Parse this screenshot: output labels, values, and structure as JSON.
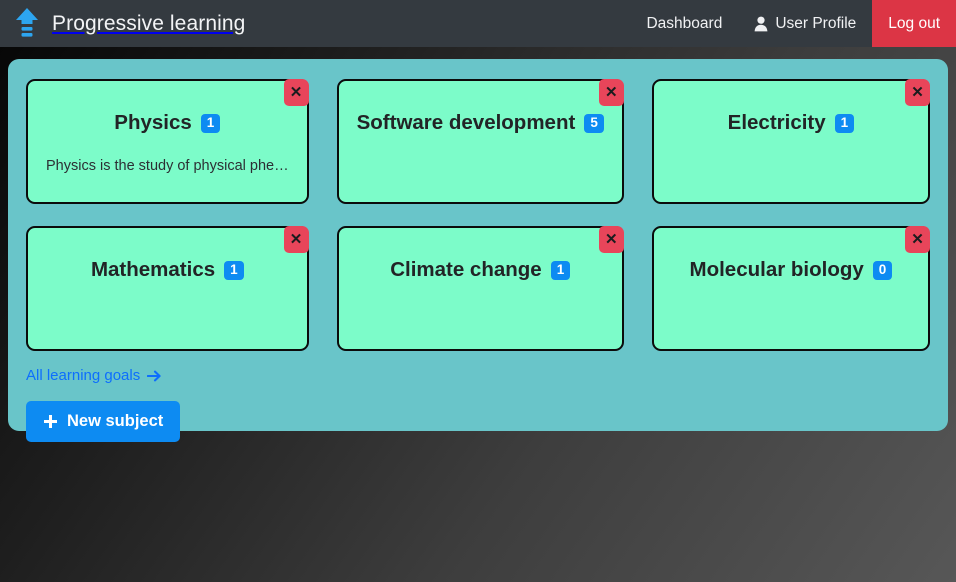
{
  "navbar": {
    "logo_icon": "level-up-arrow-icon",
    "brand_title": "Progressive learning",
    "links": [
      {
        "label": "Dashboard",
        "icon": ""
      },
      {
        "label": "User Profile",
        "icon": "person-icon"
      }
    ],
    "logout_label": "Log out",
    "background_color": "#343a40",
    "logout_color": "#dc3545",
    "logo_color": "#2da5f0"
  },
  "panel": {
    "background_color": "#69c5c9",
    "subjects": [
      {
        "title": "Physics",
        "badge": "1",
        "description": "Physics is the study of physical phe…",
        "close_label": "✕"
      },
      {
        "title": "Software development",
        "badge": "5",
        "description": "",
        "close_label": "✕"
      },
      {
        "title": "Electricity",
        "badge": "1",
        "description": "",
        "close_label": "✕"
      },
      {
        "title": "Mathematics",
        "badge": "1",
        "description": "",
        "close_label": "✕"
      },
      {
        "title": "Climate change",
        "badge": "1",
        "description": "",
        "close_label": "✕"
      },
      {
        "title": "Molecular biology",
        "badge": "0",
        "description": "",
        "close_label": "✕"
      }
    ],
    "card_color": "#7cfcc9",
    "badge_color": "#0d8bf2",
    "close_color": "#e8455a",
    "goals_link_label": "All learning goals",
    "goals_link_icon": "arrow-right-icon",
    "goals_link_color": "#0d6efd",
    "new_subject_label": "New subject",
    "new_subject_icon": "plus-icon",
    "new_subject_color": "#0d8bf2"
  }
}
